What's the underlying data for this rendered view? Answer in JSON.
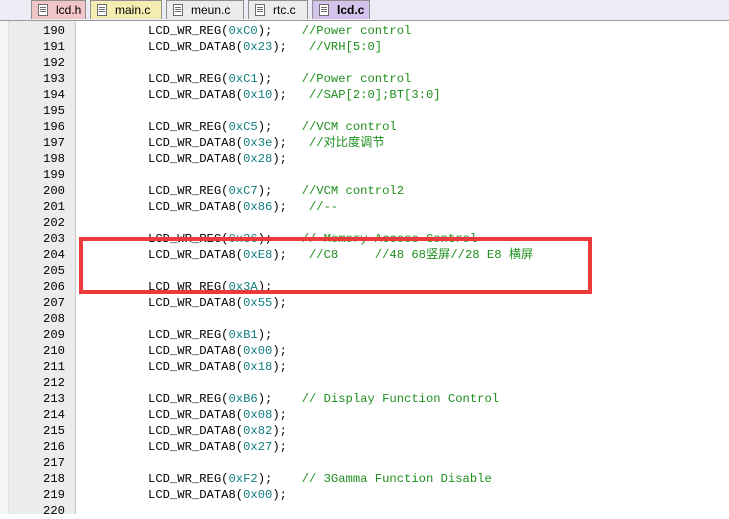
{
  "tabs": [
    {
      "label": "lcd.h",
      "active": false,
      "color": "#f2c6c9"
    },
    {
      "label": "main.c",
      "active": false,
      "color": "#f4ecb0"
    },
    {
      "label": "meun.c",
      "active": false,
      "color": "#ececec"
    },
    {
      "label": "rtc.c",
      "active": false,
      "color": "#ececec"
    },
    {
      "label": "lcd.c",
      "active": true,
      "color": "#d4c4ec"
    }
  ],
  "lines": [
    {
      "n": "190",
      "fn": "LCD_WR_REG(",
      "arg": "0xC0",
      "post": ");",
      "comment": "//Power control"
    },
    {
      "n": "191",
      "fn": "LCD_WR_DATA8(",
      "arg": "0x23",
      "post": ");",
      "comment": "//VRH[5:0]"
    },
    {
      "n": "192",
      "fn": "",
      "arg": "",
      "post": "",
      "comment": ""
    },
    {
      "n": "193",
      "fn": "LCD_WR_REG(",
      "arg": "0xC1",
      "post": ");",
      "comment": "//Power control"
    },
    {
      "n": "194",
      "fn": "LCD_WR_DATA8(",
      "arg": "0x10",
      "post": ");",
      "comment": "//SAP[2:0];BT[3:0]"
    },
    {
      "n": "195",
      "fn": "",
      "arg": "",
      "post": "",
      "comment": ""
    },
    {
      "n": "196",
      "fn": "LCD_WR_REG(",
      "arg": "0xC5",
      "post": ");",
      "comment": "//VCM control"
    },
    {
      "n": "197",
      "fn": "LCD_WR_DATA8(",
      "arg": "0x3e",
      "post": ");",
      "comment": "//对比度调节"
    },
    {
      "n": "198",
      "fn": "LCD_WR_DATA8(",
      "arg": "0x28",
      "post": ");",
      "comment": ""
    },
    {
      "n": "199",
      "fn": "",
      "arg": "",
      "post": "",
      "comment": ""
    },
    {
      "n": "200",
      "fn": "LCD_WR_REG(",
      "arg": "0xC7",
      "post": ");",
      "comment": "//VCM control2"
    },
    {
      "n": "201",
      "fn": "LCD_WR_DATA8(",
      "arg": "0x86",
      "post": ");",
      "comment": "//--"
    },
    {
      "n": "202",
      "fn": "",
      "arg": "",
      "post": "",
      "comment": ""
    },
    {
      "n": "203",
      "fn": "LCD_WR_REG(",
      "arg": "0x36",
      "post": ");",
      "comment": "// Memory Access Control"
    },
    {
      "n": "204",
      "fn": "LCD_WR_DATA8(",
      "arg": "0xE8",
      "post": ");",
      "comment": "//C8     //48 68竖屏//28 E8 横屏"
    },
    {
      "n": "205",
      "fn": "",
      "arg": "",
      "post": "",
      "comment": ""
    },
    {
      "n": "206",
      "fn": "LCD_WR_REG(",
      "arg": "0x3A",
      "post": ");",
      "comment": ""
    },
    {
      "n": "207",
      "fn": "LCD_WR_DATA8(",
      "arg": "0x55",
      "post": ");",
      "comment": ""
    },
    {
      "n": "208",
      "fn": "",
      "arg": "",
      "post": "",
      "comment": ""
    },
    {
      "n": "209",
      "fn": "LCD_WR_REG(",
      "arg": "0xB1",
      "post": ");",
      "comment": ""
    },
    {
      "n": "210",
      "fn": "LCD_WR_DATA8(",
      "arg": "0x00",
      "post": ");",
      "comment": ""
    },
    {
      "n": "211",
      "fn": "LCD_WR_DATA8(",
      "arg": "0x18",
      "post": ");",
      "comment": ""
    },
    {
      "n": "212",
      "fn": "",
      "arg": "",
      "post": "",
      "comment": ""
    },
    {
      "n": "213",
      "fn": "LCD_WR_REG(",
      "arg": "0xB6",
      "post": ");",
      "comment": "// Display Function Control"
    },
    {
      "n": "214",
      "fn": "LCD_WR_DATA8(",
      "arg": "0x08",
      "post": ");",
      "comment": ""
    },
    {
      "n": "215",
      "fn": "LCD_WR_DATA8(",
      "arg": "0x82",
      "post": ");",
      "comment": ""
    },
    {
      "n": "216",
      "fn": "LCD_WR_DATA8(",
      "arg": "0x27",
      "post": ");",
      "comment": ""
    },
    {
      "n": "217",
      "fn": "",
      "arg": "",
      "post": "",
      "comment": ""
    },
    {
      "n": "218",
      "fn": "LCD_WR_REG(",
      "arg": "0xF2",
      "post": ");",
      "comment": "// 3Gamma Function Disable"
    },
    {
      "n": "219",
      "fn": "LCD_WR_DATA8(",
      "arg": "0x00",
      "post": ");",
      "comment": ""
    },
    {
      "n": "220",
      "fn": "",
      "arg": "",
      "post": "",
      "comment": ""
    }
  ],
  "colors": {
    "number": "#117f7f",
    "comment": "#1e8f1e",
    "highlight": "#ec3a3a"
  }
}
